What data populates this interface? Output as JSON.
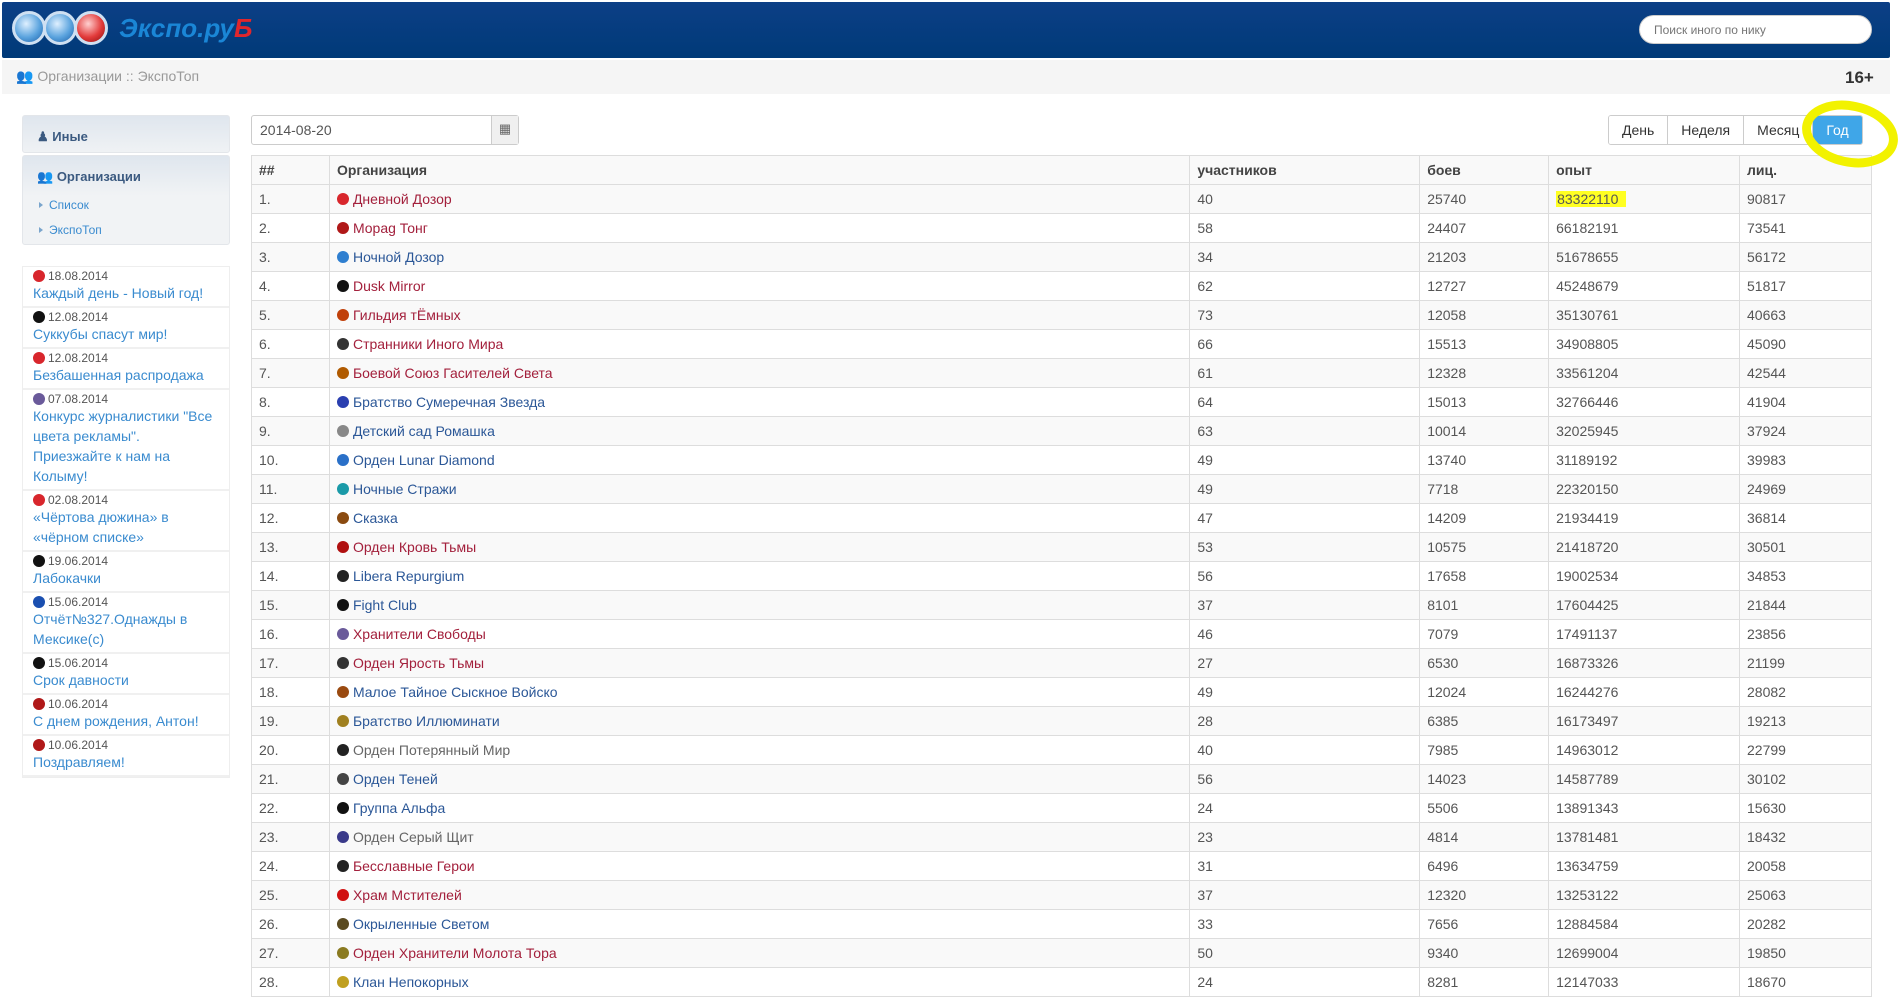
{
  "header": {
    "brand_main": "Экспо.ру",
    "brand_accent": "Б",
    "search_placeholder": "Поиск иного по нику"
  },
  "breadcrumb": "Организации :: ЭкспоТоп",
  "age_rating": "16+",
  "sidebar": {
    "others": "Иные",
    "orgs": "Организации",
    "sub": [
      "Список",
      "ЭкспоТоп"
    ]
  },
  "news": [
    {
      "icon": "day-watch",
      "date": "18.08.2014",
      "title": "Каждый день - Новый год!"
    },
    {
      "icon": "succubus",
      "date": "12.08.2014",
      "title": "Суккубы спасут мир!"
    },
    {
      "icon": "day-watch",
      "date": "12.08.2014",
      "title": "Безбашенная распродажа"
    },
    {
      "icon": "freedom",
      "date": "07.08.2014",
      "title": "Конкурс журналистики \"Все цвета рекламы\". Приезжайте к нам на Колыму!"
    },
    {
      "icon": "day-watch",
      "date": "02.08.2014",
      "title": "«Чёртова дюжина» в «чёрном списке»"
    },
    {
      "icon": "succubus",
      "date": "19.06.2014",
      "title": "Лабокачки"
    },
    {
      "icon": "blue-flag",
      "date": "15.06.2014",
      "title": "Отчёт№327.Однажды в Мексике(с)"
    },
    {
      "icon": "succubus",
      "date": "15.06.2014",
      "title": "Срок давности"
    },
    {
      "icon": "morag",
      "date": "10.06.2014",
      "title": "С днем рождения, Антон!"
    },
    {
      "icon": "morag",
      "date": "10.06.2014",
      "title": "Поздравляем!"
    }
  ],
  "filter": {
    "date": "2014-08-20",
    "periods": [
      "День",
      "Неделя",
      "Месяц",
      "Год"
    ],
    "active_period": "Год"
  },
  "colors": {
    "dark": "#a3203c",
    "light": "#2b5797",
    "neutral": "#666666",
    "highlight": "#ffff22",
    "annotation": "#f2f200"
  },
  "table": {
    "headers": [
      "##",
      "Организация",
      "участников",
      "боев",
      "опыт",
      "лиц."
    ],
    "highlighted_cell": "83322110",
    "rows": [
      [
        "1.",
        "Дневной Дозор",
        "40",
        "25740",
        "83322110",
        "90817",
        "dark",
        "#d8262c"
      ],
      [
        "2.",
        "Морag Тонг",
        "58",
        "24407",
        "66182191",
        "73541",
        "dark",
        "#b01818"
      ],
      [
        "3.",
        "Ночной Дозор",
        "34",
        "21203",
        "51678655",
        "56172",
        "light",
        "#2f7fd0"
      ],
      [
        "4.",
        "Dusk Mirror",
        "62",
        "12727",
        "45248679",
        "51817",
        "dark",
        "#111111"
      ],
      [
        "5.",
        "Гильдия тЁмных",
        "73",
        "12058",
        "35130761",
        "40663",
        "dark",
        "#c0400a"
      ],
      [
        "6.",
        "Странники Иного Мира",
        "66",
        "15513",
        "34908805",
        "45090",
        "dark",
        "#333333"
      ],
      [
        "7.",
        "Боевой Союз Гасителей Света",
        "61",
        "12328",
        "33561204",
        "42544",
        "dark",
        "#b05a00"
      ],
      [
        "8.",
        "Братство Сумеречная Звезда",
        "64",
        "15013",
        "32766446",
        "41904",
        "light",
        "#2a3fb0"
      ],
      [
        "9.",
        "Детский сад Ромашка",
        "63",
        "10014",
        "32025945",
        "37924",
        "light",
        "#888888"
      ],
      [
        "10.",
        "Орден Lunar Diamond",
        "49",
        "13740",
        "31189192",
        "39983",
        "light",
        "#2a70c8"
      ],
      [
        "11.",
        "Ночные Стражи",
        "49",
        "7718",
        "22320150",
        "24969",
        "light",
        "#1a9aa8"
      ],
      [
        "12.",
        "Сказка",
        "47",
        "14209",
        "21934419",
        "36814",
        "light",
        "#8a4a10"
      ],
      [
        "13.",
        "Орден Кровь Тьмы",
        "53",
        "10575",
        "21418720",
        "30501",
        "dark",
        "#b01010"
      ],
      [
        "14.",
        "Libera Repurgium",
        "56",
        "17658",
        "19002534",
        "34853",
        "light",
        "#222222"
      ],
      [
        "15.",
        "Fight Club",
        "37",
        "8101",
        "17604425",
        "21844",
        "light",
        "#111111"
      ],
      [
        "16.",
        "Хранители Свободы",
        "46",
        "7079",
        "17491137",
        "23856",
        "dark",
        "#6a5a9a"
      ],
      [
        "17.",
        "Орден Ярость Тьмы",
        "27",
        "6530",
        "16873326",
        "21199",
        "dark",
        "#333333"
      ],
      [
        "18.",
        "Малое Тайное Сыскное Войско",
        "49",
        "12024",
        "16244276",
        "28082",
        "light",
        "#9a4a10"
      ],
      [
        "19.",
        "Братство Иллюминати",
        "28",
        "6385",
        "16173497",
        "19213",
        "light",
        "#a08020"
      ],
      [
        "20.",
        "Орден Потерянный Мир",
        "40",
        "7985",
        "14963012",
        "22799",
        "neutral",
        "#222222"
      ],
      [
        "21.",
        "Орден Теней",
        "56",
        "14023",
        "14587789",
        "30102",
        "light",
        "#444444"
      ],
      [
        "22.",
        "Группа Альфа",
        "24",
        "5506",
        "13891343",
        "15630",
        "light",
        "#111111"
      ],
      [
        "23.",
        "Орден Серый Щит",
        "23",
        "4814",
        "13781481",
        "18432",
        "neutral",
        "#3a3a8a"
      ],
      [
        "24.",
        "Бесславные Герои",
        "31",
        "6496",
        "13634759",
        "20058",
        "dark",
        "#222222"
      ],
      [
        "25.",
        "Храм Мстителей",
        "37",
        "12320",
        "13253122",
        "25063",
        "dark",
        "#d01010"
      ],
      [
        "26.",
        "Окрыленные Светом",
        "33",
        "7656",
        "12884584",
        "20282",
        "light",
        "#5a4a20"
      ],
      [
        "27.",
        "Орден Хранители Молота Тора",
        "50",
        "9340",
        "12699004",
        "19850",
        "dark",
        "#8a7a20"
      ],
      [
        "28.",
        "Клан Непокорных",
        "24",
        "8281",
        "12147033",
        "18670",
        "light",
        "#c0a020"
      ]
    ]
  }
}
